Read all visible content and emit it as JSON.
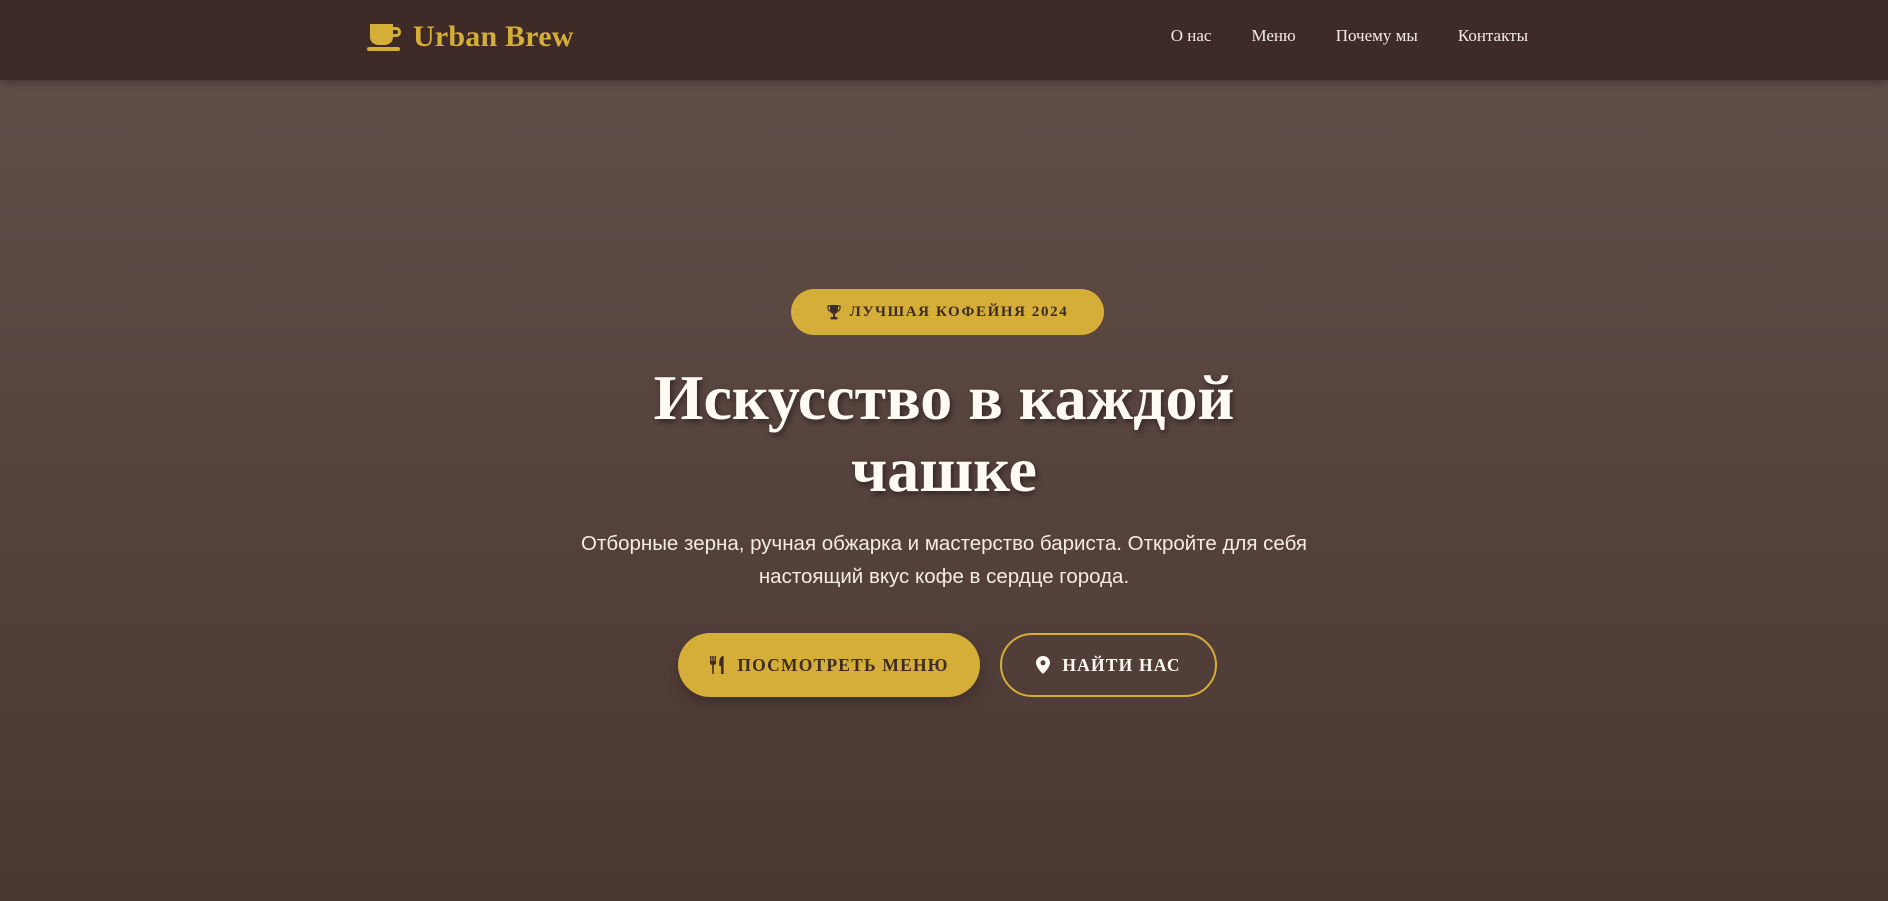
{
  "brand": {
    "name": "Urban Brew",
    "icon": "coffee-cup-icon",
    "color": "#d4ae38"
  },
  "nav": {
    "links": [
      {
        "label": "О нас"
      },
      {
        "label": "Меню"
      },
      {
        "label": "Почему мы"
      },
      {
        "label": "Контакты"
      }
    ]
  },
  "hero": {
    "badge": {
      "icon": "trophy-icon",
      "label": "ЛУЧШАЯ КОФЕЙНЯ 2024"
    },
    "title_line1": "Искусство в каждой",
    "title_line2": "чашке",
    "subtitle_line1": "Отборные зерна, ручная обжарка и мастерство бариста. Откройте для себя",
    "subtitle_line2": "настоящий вкус кофе в сердце города.",
    "primary_button": {
      "icon": "utensils-icon",
      "label": "ПОСМОТРЕТЬ МЕНЮ"
    },
    "secondary_button": {
      "icon": "map-pin-icon",
      "label": "НАЙТИ НАС"
    }
  },
  "colors": {
    "nav_background": "#3e2a26",
    "hero_background": "#57433d",
    "accent": "#d4ae38",
    "text_light": "#fffaf2"
  }
}
